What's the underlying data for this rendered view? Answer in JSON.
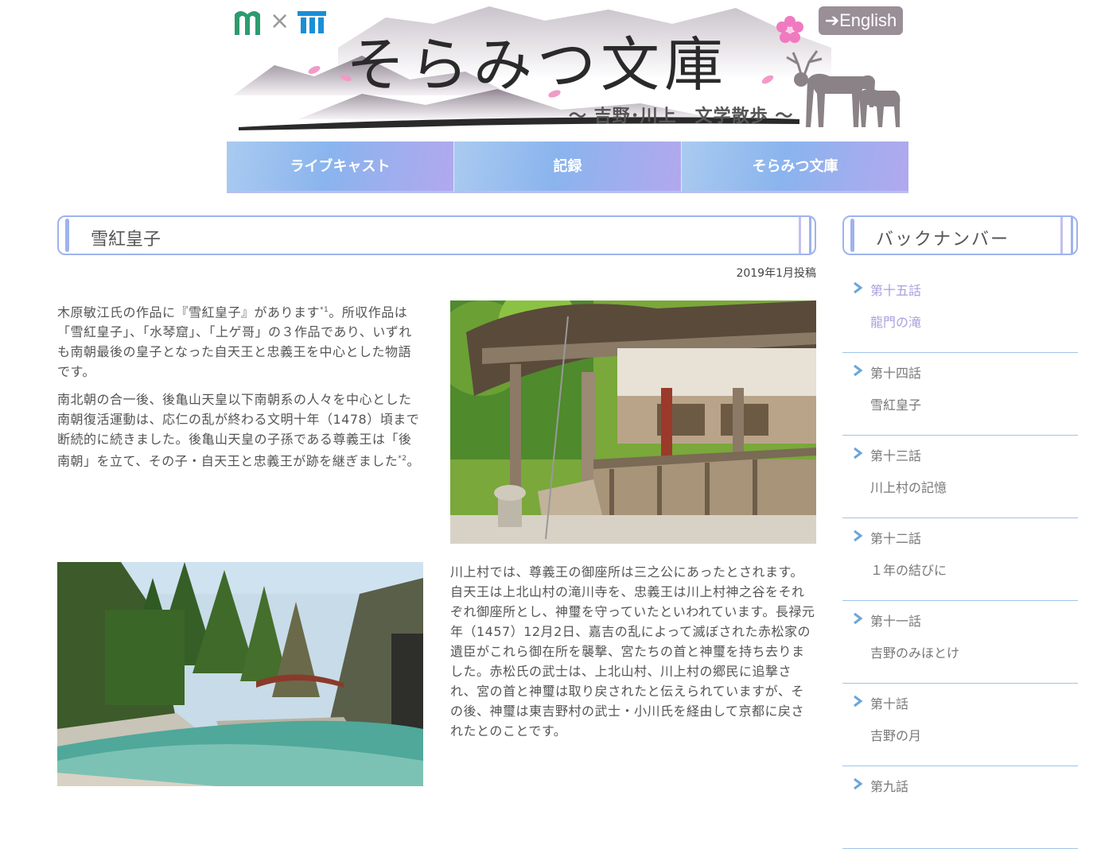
{
  "header": {
    "logo_separator": "×",
    "site_title": "そらみつ文庫",
    "site_subtitle": "～ 吉野･川上　文学散歩 ～",
    "english_label": "➔English"
  },
  "nav": {
    "items": [
      {
        "label": "ライブキャスト"
      },
      {
        "label": "記録"
      },
      {
        "label": "そらみつ文庫"
      }
    ]
  },
  "article": {
    "title": "雪紅皇子",
    "date": "2019年1月投稿",
    "p1_main": "木原敏江氏の作品に『雪紅皇子』があります",
    "p1_note": "*1",
    "p1_rest": "。所収作品は「雪紅皇子」、「水琴窟」、「上ゲ哥」の３作品であり、いずれも南朝最後の皇子となった自天王と忠義王を中心とした物語です。",
    "p2_main": "南北朝の合一後、後亀山天皇以下南朝系の人々を中心とした南朝復活運動は、応仁の乱が終わる文明十年（1478）頃まで断続的に続きました。後亀山天皇の子孫である尊義王は「後南朝」を立て、その子・自天王と忠義王が跡を継ぎました",
    "p2_note": "*2",
    "p2_end": "。",
    "p3": "川上村では、尊義王の御座所は三之公にあったとされます。自天王は上北山村の滝川寺を、忠義王は川上村神之谷をそれぞれ御座所とし、神璽を守っていたといわれています。長禄元年（1457）12月2日、嘉吉の乱によって滅ぼされた赤松家の遺臣がこれら御在所を襲撃、宮たちの首と神璽を持ち去りました。赤松氏の武士は、上北山村、川上村の郷民に追撃され、宮の首と神璽は取り戻されたと伝えられていますが、その後、神璽は東吉野村の武士・小川氏を経由して京都に戻されたとのことです。"
  },
  "sidebar": {
    "title": "バックナンバー",
    "items": [
      {
        "episode": "第十五話",
        "title": "龍門の滝",
        "active": true
      },
      {
        "episode": "第十四話",
        "title": "雪紅皇子",
        "active": false
      },
      {
        "episode": "第十三話",
        "title": "川上村の記憶",
        "active": false
      },
      {
        "episode": "第十二話",
        "title": "１年の結びに",
        "active": false
      },
      {
        "episode": "第十一話",
        "title": "吉野のみほとけ",
        "active": false
      },
      {
        "episode": "第十話",
        "title": "吉野の月",
        "active": false
      },
      {
        "episode": "第九話",
        "title": "",
        "active": false
      }
    ]
  },
  "colors": {
    "accent": "#9eb3ee",
    "nav_gradient_start": "#aacbf0",
    "nav_gradient_end": "#b2a8ee",
    "active_link": "#a7a0dc",
    "chevron": "#6aa6dc",
    "divider": "#9ec4e8",
    "english_button": "#9a8f96"
  },
  "icons": {
    "chevron": "chevron-right-icon",
    "english": "arrow-right-icon"
  }
}
